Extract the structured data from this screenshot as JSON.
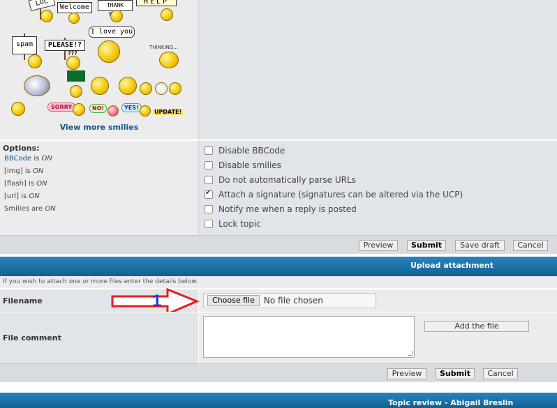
{
  "smilies": {
    "signs": [
      "LOL",
      "Welcome",
      "THANK YOU!",
      "HELP",
      "spam",
      "PLEASE!?",
      "???"
    ],
    "speech": "I love you",
    "thinking": "THINKING...",
    "bubbles": [
      "SORRY",
      "NO!",
      "YES!"
    ],
    "update": "UPDATE!",
    "view_more": "View more smilies"
  },
  "options": {
    "title": "Options:",
    "status": [
      {
        "name": "BBCode",
        "suffix": " is ",
        "state": "ON"
      },
      {
        "name": "[img]",
        "suffix": " is ",
        "state": "ON"
      },
      {
        "name": "[flash]",
        "suffix": " is ",
        "state": "ON"
      },
      {
        "name": "[url]",
        "suffix": " is ",
        "state": "ON"
      },
      {
        "name": "Smilies",
        "suffix": " are ",
        "state": "ON"
      }
    ],
    "checkboxes": [
      {
        "label": "Disable BBCode",
        "checked": false
      },
      {
        "label": "Disable smilies",
        "checked": false
      },
      {
        "label": "Do not automatically parse URLs",
        "checked": false
      },
      {
        "label": "Attach a signature (signatures can be altered via the UCP)",
        "checked": true
      },
      {
        "label": "Notify me when a reply is posted",
        "checked": false
      },
      {
        "label": "Lock topic",
        "checked": false
      }
    ]
  },
  "buttons_top": {
    "preview": "Preview",
    "submit": "Submit",
    "save_draft": "Save draft",
    "cancel": "Cancel"
  },
  "upload": {
    "title": "Upload attachment",
    "intro": "If you wish to attach one or more files enter the details below.",
    "filename_label": "Filename",
    "choose_file": "Choose file",
    "no_file": "No file chosen",
    "annotation": "1",
    "comment_label": "File comment",
    "add_file": "Add the file"
  },
  "buttons_bottom": {
    "preview": "Preview",
    "submit": "Submit",
    "cancel": "Cancel"
  },
  "topic_review": {
    "title": "Topic review - Abigail Breslin"
  },
  "colors": {
    "link": "#105289",
    "blue_bar": "#1a6fa5",
    "arrow": "#e02020",
    "annotation": "#1a3fd8"
  }
}
